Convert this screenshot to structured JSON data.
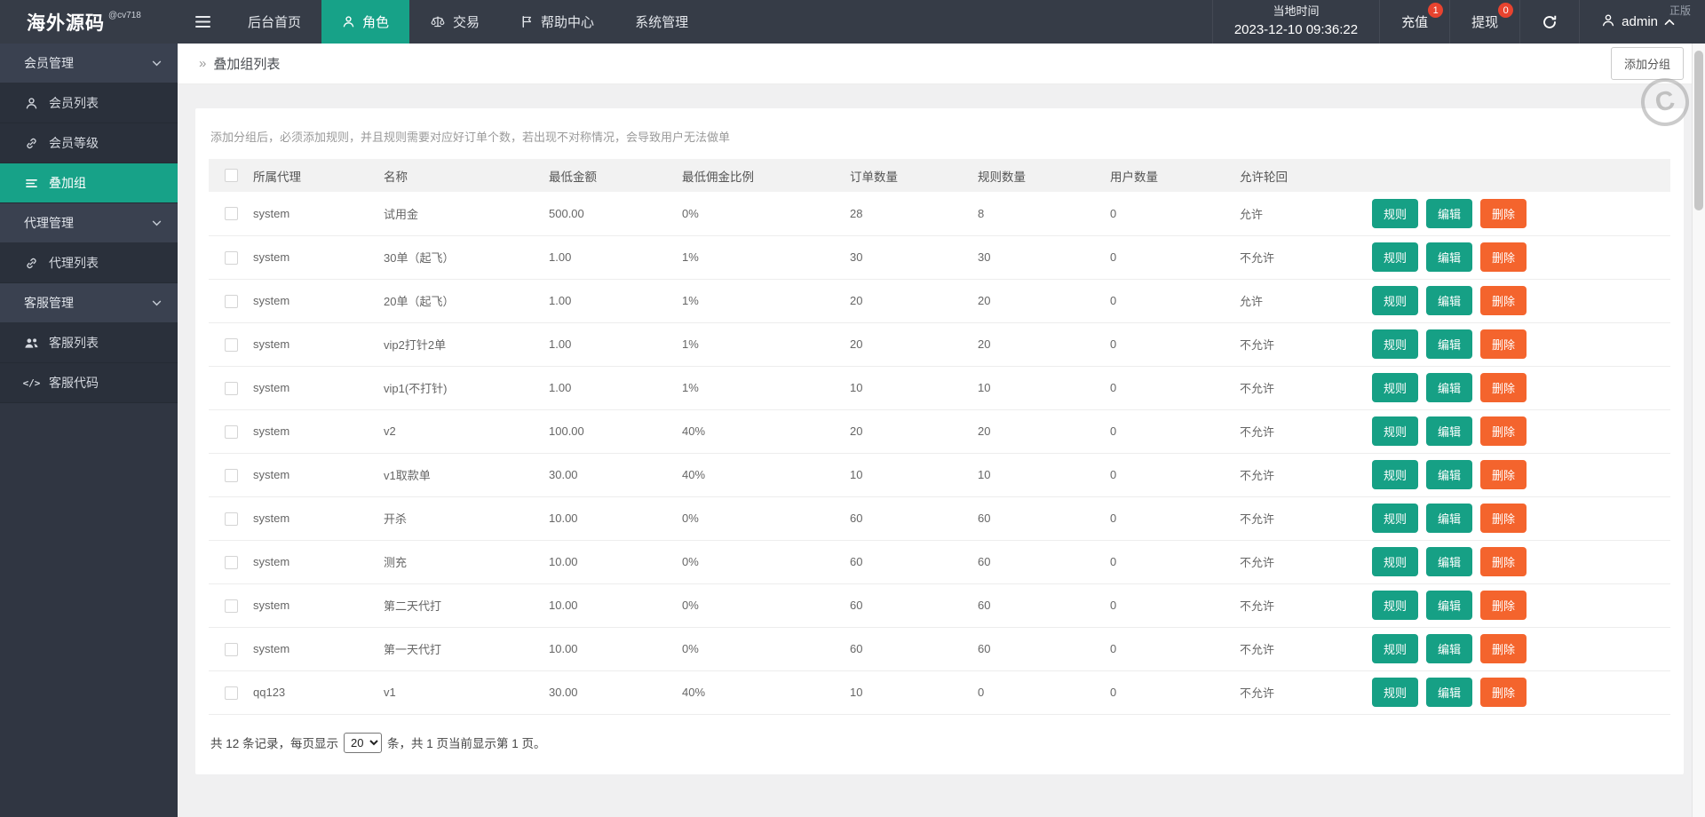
{
  "topbar": {
    "logo": "海外源码",
    "logo_badge": "@cv718",
    "nav": [
      {
        "label": "后台首页",
        "icon": null,
        "active": false
      },
      {
        "label": "角色",
        "icon": "user",
        "active": true
      },
      {
        "label": "交易",
        "icon": "scales",
        "active": false
      },
      {
        "label": "帮助中心",
        "icon": "flag",
        "active": false
      },
      {
        "label": "系统管理",
        "icon": null,
        "active": false
      }
    ],
    "time_label": "当地时间",
    "time_value": "2023-12-10 09:36:22",
    "recharge_label": "充值",
    "recharge_badge": "1",
    "withdraw_label": "提现",
    "withdraw_badge": "0",
    "admin_label": "admin",
    "corner_watermark": "正版"
  },
  "sidebar": {
    "items": [
      {
        "type": "group",
        "label": "会员管理"
      },
      {
        "type": "item",
        "label": "会员列表",
        "icon": "user",
        "active": false
      },
      {
        "type": "item",
        "label": "会员等级",
        "icon": "link",
        "active": false
      },
      {
        "type": "item",
        "label": "叠加组",
        "icon": "list",
        "active": true
      },
      {
        "type": "group",
        "label": "代理管理"
      },
      {
        "type": "item",
        "label": "代理列表",
        "icon": "link",
        "active": false
      },
      {
        "type": "group",
        "label": "客服管理"
      },
      {
        "type": "item",
        "label": "客服列表",
        "icon": "users",
        "active": false
      },
      {
        "type": "item",
        "label": "客服代码",
        "icon": "code",
        "active": false
      }
    ]
  },
  "breadcrumb": {
    "title": "叠加组列表"
  },
  "toolbar": {
    "add_group_label": "添加分组"
  },
  "hint": "添加分组后，必须添加规则，并且规则需要对应好订单个数，若出现不对称情况，会导致用户无法做单",
  "table": {
    "headers": [
      "所属代理",
      "名称",
      "最低金额",
      "最低佣金比例",
      "订单数量",
      "规则数量",
      "用户数量",
      "允许轮回"
    ],
    "rows": [
      {
        "agent": "system",
        "name": "试用金",
        "min_amount": "500.00",
        "min_commission": "0%",
        "orders": "28",
        "rules": "8",
        "users": "0",
        "loop": "允许"
      },
      {
        "agent": "system",
        "name": "30单（起飞）",
        "min_amount": "1.00",
        "min_commission": "1%",
        "orders": "30",
        "rules": "30",
        "users": "0",
        "loop": "不允许"
      },
      {
        "agent": "system",
        "name": "20单（起飞）",
        "min_amount": "1.00",
        "min_commission": "1%",
        "orders": "20",
        "rules": "20",
        "users": "0",
        "loop": "允许"
      },
      {
        "agent": "system",
        "name": "vip2打针2单",
        "min_amount": "1.00",
        "min_commission": "1%",
        "orders": "20",
        "rules": "20",
        "users": "0",
        "loop": "不允许"
      },
      {
        "agent": "system",
        "name": "vip1(不打针)",
        "min_amount": "1.00",
        "min_commission": "1%",
        "orders": "10",
        "rules": "10",
        "users": "0",
        "loop": "不允许"
      },
      {
        "agent": "system",
        "name": "v2",
        "min_amount": "100.00",
        "min_commission": "40%",
        "orders": "20",
        "rules": "20",
        "users": "0",
        "loop": "不允许"
      },
      {
        "agent": "system",
        "name": "v1取款单",
        "min_amount": "30.00",
        "min_commission": "40%",
        "orders": "10",
        "rules": "10",
        "users": "0",
        "loop": "不允许"
      },
      {
        "agent": "system",
        "name": "开杀",
        "min_amount": "10.00",
        "min_commission": "0%",
        "orders": "60",
        "rules": "60",
        "users": "0",
        "loop": "不允许"
      },
      {
        "agent": "system",
        "name": "测充",
        "min_amount": "10.00",
        "min_commission": "0%",
        "orders": "60",
        "rules": "60",
        "users": "0",
        "loop": "不允许"
      },
      {
        "agent": "system",
        "name": "第二天代打",
        "min_amount": "10.00",
        "min_commission": "0%",
        "orders": "60",
        "rules": "60",
        "users": "0",
        "loop": "不允许"
      },
      {
        "agent": "system",
        "name": "第一天代打",
        "min_amount": "10.00",
        "min_commission": "0%",
        "orders": "60",
        "rules": "60",
        "users": "0",
        "loop": "不允许"
      },
      {
        "agent": "qq123",
        "name": "v1",
        "min_amount": "30.00",
        "min_commission": "40%",
        "orders": "10",
        "rules": "0",
        "users": "0",
        "loop": "不允许"
      }
    ]
  },
  "actions": {
    "rule": "规则",
    "edit": "编辑",
    "delete": "删除"
  },
  "pagination": {
    "prefix": "共 12 条记录，每页显示",
    "page_size": "20",
    "suffix": "条，共 1 页当前显示第 1 页。"
  },
  "colors": {
    "accent": "#17a288",
    "button_teal": "#16a085",
    "button_orange": "#f4642d",
    "badge_red": "#e8432f",
    "topbar_bg": "#363c47",
    "sidebar_bg": "#303642"
  }
}
